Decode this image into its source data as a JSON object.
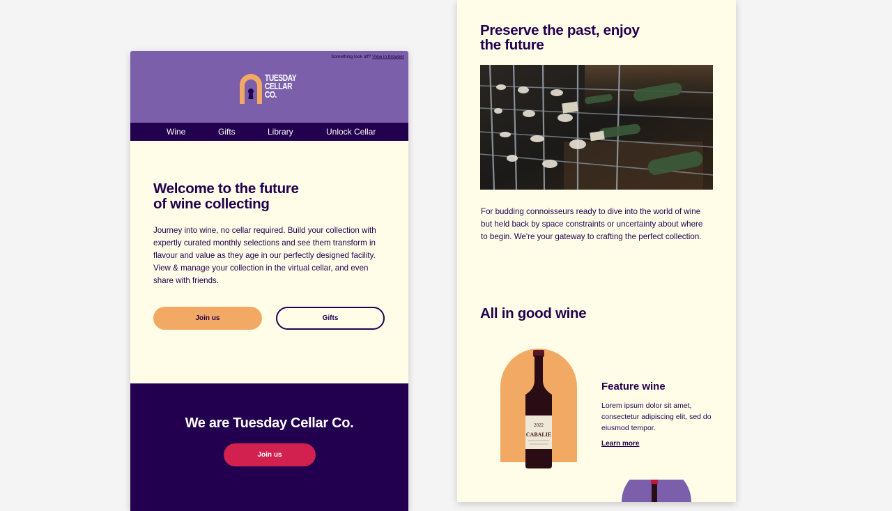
{
  "left_email": {
    "preheader_text": "Something look off?",
    "preheader_link": "View in browser",
    "brand": {
      "line1": "TUESDAY",
      "line2": "CELLAR",
      "line3": "CO."
    },
    "nav": [
      "Wine",
      "Gifts",
      "Library",
      "Unlock Cellar"
    ],
    "hero": {
      "title_line1": "Welcome to the future",
      "title_line2": "of wine collecting",
      "body": "Journey into wine, no cellar required. Build your collection with expertly curated monthly selections and see them transform in flavour and value as they age in our perfectly designed facility. View & manage your collection in the virtual cellar, and even share with friends.",
      "join_label": "Join us",
      "gifts_label": "Gifts"
    },
    "footer": {
      "title": "We are Tuesday Cellar Co.",
      "join_label": "Join us"
    }
  },
  "right_email": {
    "section_title_line1": "Preserve the past, enjoy",
    "section_title_line2": "the future",
    "body": "For budding connoisseurs ready to dive into the world of wine but held back by space constraints or uncertainty about where to begin. We're your gateway to crafting the perfect collection.",
    "products_heading": "All in good wine",
    "feature": {
      "title": "Feature wine",
      "body": "Lorem ipsum dolor sit amet, consectetur adipiscing elit, sed do eiusmod tempor.",
      "link": "Learn more",
      "label_year": "2022",
      "label_name": "CABALIE"
    }
  },
  "colors": {
    "page_bg": "#f4f4f4",
    "email_bg": "#fffde7",
    "brand_purple": "#7b5fab",
    "navy": "#23004f",
    "peach": "#f2a963",
    "raspberry": "#d2204f"
  },
  "icons": {
    "logo": "keyhole-arch-logo-icon"
  }
}
